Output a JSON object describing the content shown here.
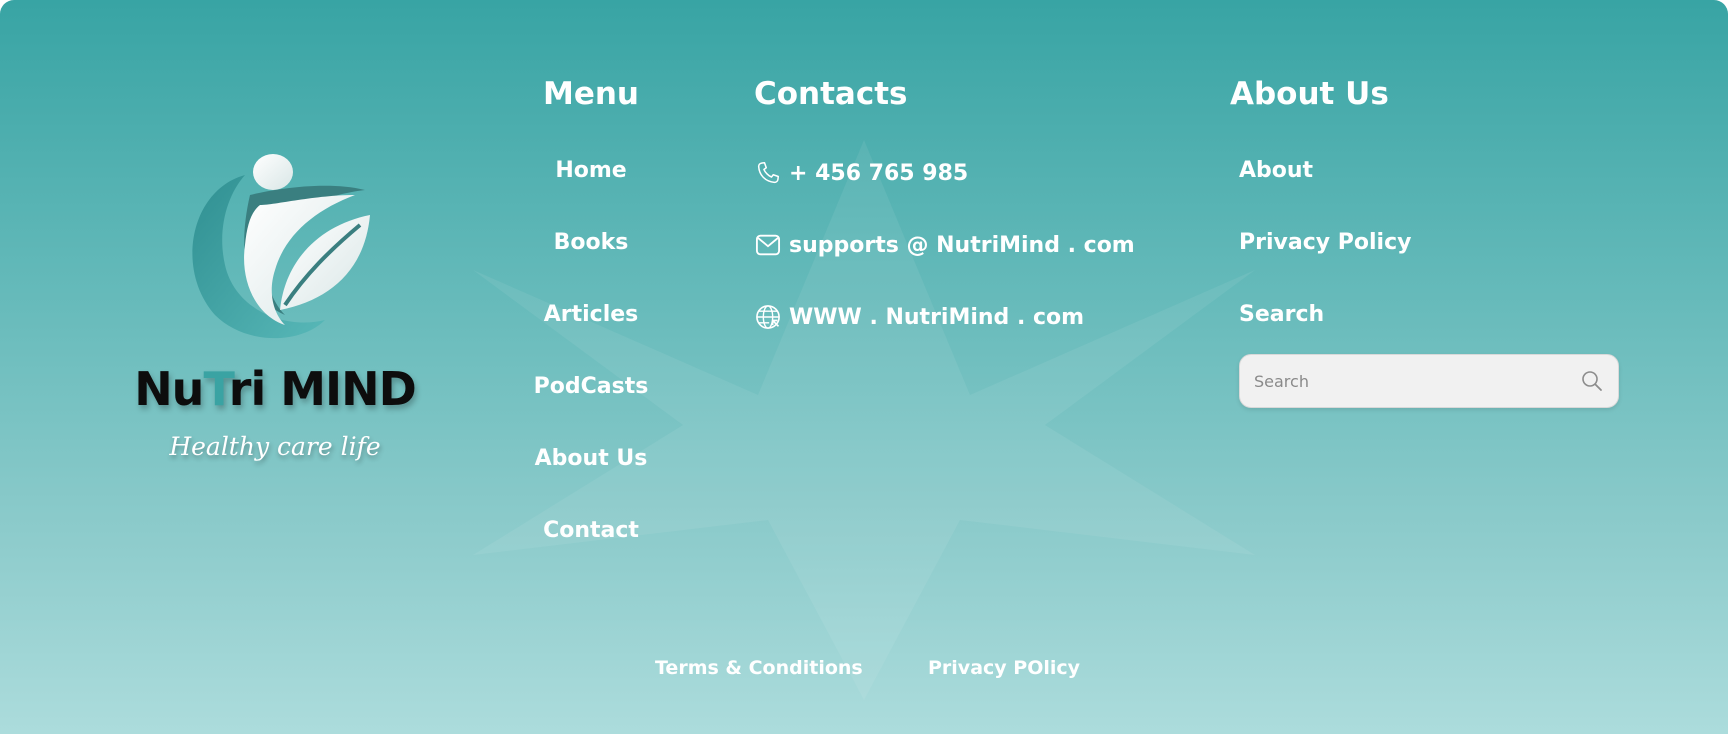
{
  "brand": {
    "name_prefix": "Nu",
    "name_accent": "T",
    "name_suffix": "ri MIND",
    "tagline": "Healthy care life"
  },
  "menu": {
    "title": "Menu",
    "items": [
      "Home",
      "Books",
      "Articles",
      "PodCasts",
      "About Us",
      "Contact"
    ]
  },
  "contacts": {
    "title": "Contacts",
    "phone": "+ 456 765 985",
    "email": "supports @ NutriMind . com",
    "website": "WWW . NutriMind . com"
  },
  "about": {
    "title": "About Us",
    "items": [
      "About",
      "Privacy Policy",
      "Search"
    ],
    "search_placeholder": "Search"
  },
  "bottom": {
    "terms": "Terms & Conditions",
    "privacy": "Privacy POlicy"
  },
  "colors": {
    "teal_top": "#38a4a4",
    "teal_bottom": "#acdcdc",
    "text": "#ffffff"
  }
}
